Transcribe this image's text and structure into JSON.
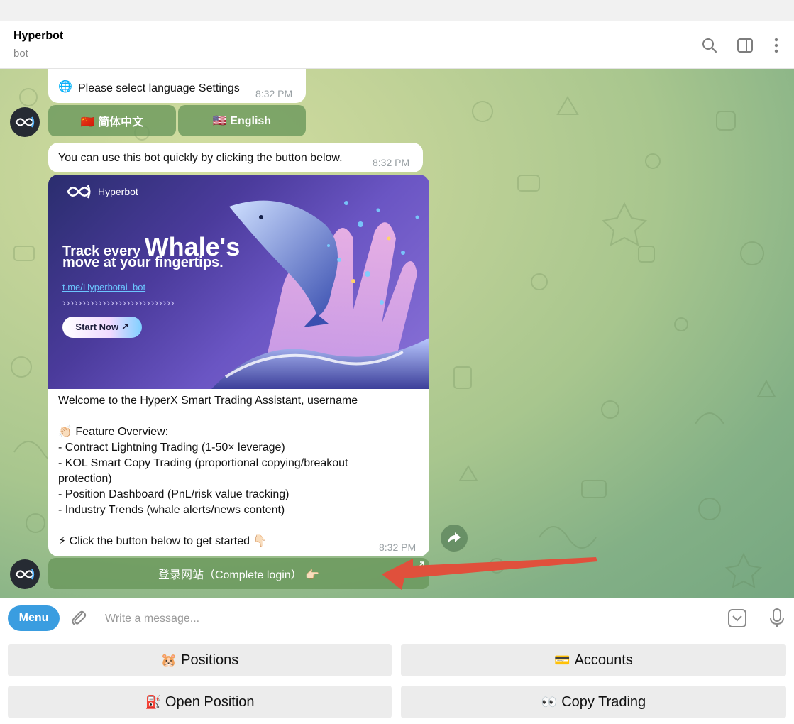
{
  "header": {
    "title": "Hyperbot",
    "subtitle": "bot"
  },
  "messages": {
    "language_prompt": {
      "icon": "🌐",
      "text": "Please select language Settings",
      "time": "8:32 PM"
    },
    "lang_buttons": [
      {
        "label": "🇨🇳 简体中文"
      },
      {
        "label": "🇺🇸 English"
      }
    ],
    "quick_use": {
      "text": "You can use this bot quickly by clicking the button below.",
      "time": "8:32 PM"
    },
    "banner": {
      "brand": "Hyperbot",
      "line1a": "Track every",
      "line1b": "Whale's",
      "line2": "move at your fingertips.",
      "link": "t.me/Hyperbotai_bot",
      "arrows": "››››››››››››››››››››››››››››",
      "cta": "Start Now ↗"
    },
    "welcome": {
      "line1": "Welcome to the HyperX Smart Trading Assistant, username",
      "feature_title": "👏🏻 Feature Overview:",
      "items": [
        "- Contract Lightning Trading (1-50× leverage)",
        "- KOL Smart Copy Trading (proportional copying/breakout",
        "protection)",
        "- Position Dashboard (PnL/risk value tracking)",
        "- Industry Trends (whale alerts/news content)"
      ],
      "cta": "⚡ Click the button below to get started 👇🏻",
      "time": "8:32 PM"
    },
    "login_button": "登录网站（Complete login） 👉🏻"
  },
  "composer": {
    "menu_label": "Menu",
    "placeholder": "Write a message..."
  },
  "keyboard": [
    {
      "emoji": "🐹",
      "label": "Positions"
    },
    {
      "emoji": "💳",
      "label": "Accounts"
    },
    {
      "emoji": "⛽",
      "label": "Open Position"
    },
    {
      "emoji": "👀",
      "label": "Copy Trading"
    }
  ],
  "colors": {
    "accent": "#3a9de0",
    "annotation_arrow": "#e0503c"
  }
}
